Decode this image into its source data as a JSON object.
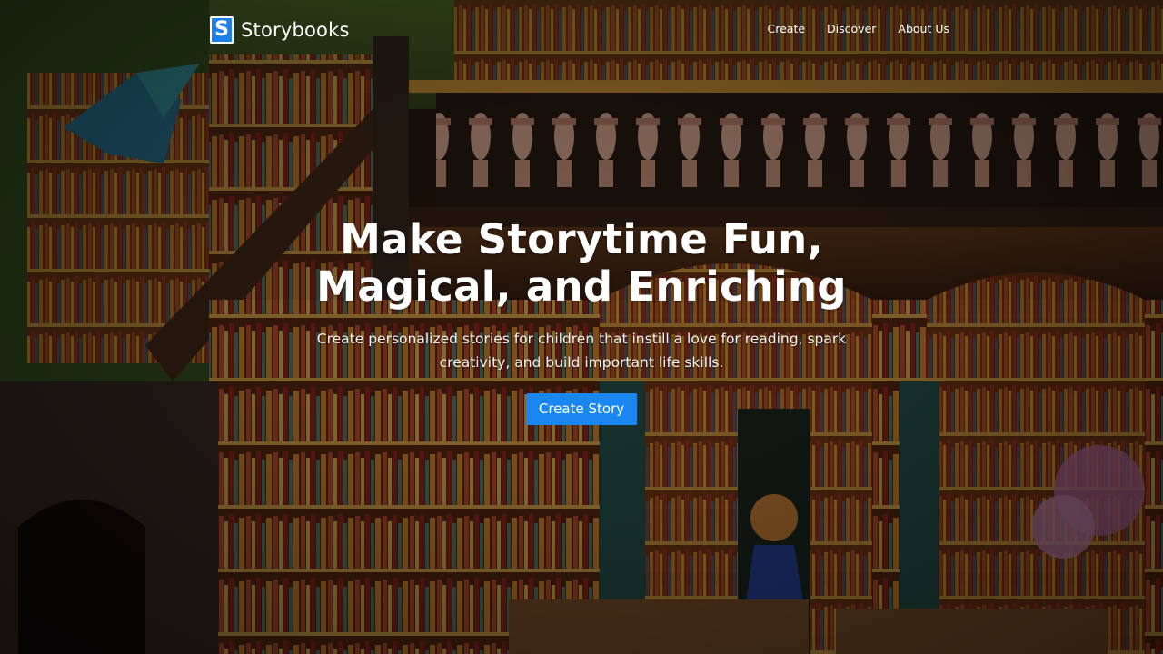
{
  "header": {
    "logo_letter": "S",
    "brand": "Storybooks",
    "nav": [
      {
        "label": "Create"
      },
      {
        "label": "Discover"
      },
      {
        "label": "About Us"
      }
    ]
  },
  "hero": {
    "title_line1": "Make Storytime Fun,",
    "title_line2": "Magical, and Enriching",
    "subtitle": "Create personalized stories for children that instill a love for reading, spark creativity, and build important life skills.",
    "cta_label": "Create Story"
  },
  "colors": {
    "accent": "#1a86f0",
    "text": "#ffffff"
  },
  "background": {
    "description_icon": "library-painting-background"
  }
}
